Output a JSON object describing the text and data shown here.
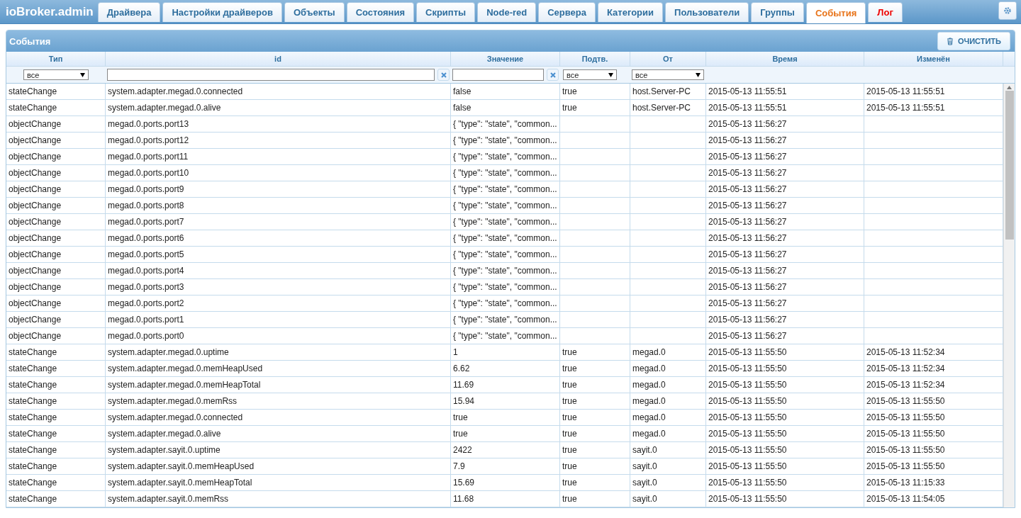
{
  "app": {
    "title": "ioBroker.admin"
  },
  "tabs": [
    {
      "label": "Драйвера",
      "selected": false,
      "warning": false
    },
    {
      "label": "Настройки драйверов",
      "selected": false,
      "warning": false
    },
    {
      "label": "Объекты",
      "selected": false,
      "warning": false
    },
    {
      "label": "Состояния",
      "selected": false,
      "warning": false
    },
    {
      "label": "Скрипты",
      "selected": false,
      "warning": false
    },
    {
      "label": "Node-red",
      "selected": false,
      "warning": false
    },
    {
      "label": "Сервера",
      "selected": false,
      "warning": false
    },
    {
      "label": "Категории",
      "selected": false,
      "warning": false
    },
    {
      "label": "Пользователи",
      "selected": false,
      "warning": false
    },
    {
      "label": "Группы",
      "selected": false,
      "warning": false
    },
    {
      "label": "События",
      "selected": true,
      "warning": false
    },
    {
      "label": "Лог",
      "selected": false,
      "warning": true
    }
  ],
  "panel": {
    "title": "События",
    "clear_button": "ОЧИСТИТЬ"
  },
  "table": {
    "columns": [
      "Тип",
      "id",
      "Значение",
      "Подтв.",
      "От",
      "Время",
      "Изменён"
    ],
    "filters": [
      {
        "kind": "select",
        "value": "все"
      },
      {
        "kind": "input"
      },
      {
        "kind": "input"
      },
      {
        "kind": "select",
        "value": "все"
      },
      {
        "kind": "select",
        "value": "все"
      },
      {
        "kind": "none"
      },
      {
        "kind": "none"
      }
    ],
    "rows": [
      [
        "stateChange",
        "system.adapter.megad.0.connected",
        "false",
        "true",
        "host.Server-PC",
        "2015-05-13 11:55:51",
        "2015-05-13 11:55:51"
      ],
      [
        "stateChange",
        "system.adapter.megad.0.alive",
        "false",
        "true",
        "host.Server-PC",
        "2015-05-13 11:55:51",
        "2015-05-13 11:55:51"
      ],
      [
        "objectChange",
        "megad.0.ports.port13",
        "{ \"type\": \"state\", \"common...",
        "",
        "",
        "2015-05-13 11:56:27",
        ""
      ],
      [
        "objectChange",
        "megad.0.ports.port12",
        "{ \"type\": \"state\", \"common...",
        "",
        "",
        "2015-05-13 11:56:27",
        ""
      ],
      [
        "objectChange",
        "megad.0.ports.port11",
        "{ \"type\": \"state\", \"common...",
        "",
        "",
        "2015-05-13 11:56:27",
        ""
      ],
      [
        "objectChange",
        "megad.0.ports.port10",
        "{ \"type\": \"state\", \"common...",
        "",
        "",
        "2015-05-13 11:56:27",
        ""
      ],
      [
        "objectChange",
        "megad.0.ports.port9",
        "{ \"type\": \"state\", \"common...",
        "",
        "",
        "2015-05-13 11:56:27",
        ""
      ],
      [
        "objectChange",
        "megad.0.ports.port8",
        "{ \"type\": \"state\", \"common...",
        "",
        "",
        "2015-05-13 11:56:27",
        ""
      ],
      [
        "objectChange",
        "megad.0.ports.port7",
        "{ \"type\": \"state\", \"common...",
        "",
        "",
        "2015-05-13 11:56:27",
        ""
      ],
      [
        "objectChange",
        "megad.0.ports.port6",
        "{ \"type\": \"state\", \"common...",
        "",
        "",
        "2015-05-13 11:56:27",
        ""
      ],
      [
        "objectChange",
        "megad.0.ports.port5",
        "{ \"type\": \"state\", \"common...",
        "",
        "",
        "2015-05-13 11:56:27",
        ""
      ],
      [
        "objectChange",
        "megad.0.ports.port4",
        "{ \"type\": \"state\", \"common...",
        "",
        "",
        "2015-05-13 11:56:27",
        ""
      ],
      [
        "objectChange",
        "megad.0.ports.port3",
        "{ \"type\": \"state\", \"common...",
        "",
        "",
        "2015-05-13 11:56:27",
        ""
      ],
      [
        "objectChange",
        "megad.0.ports.port2",
        "{ \"type\": \"state\", \"common...",
        "",
        "",
        "2015-05-13 11:56:27",
        ""
      ],
      [
        "objectChange",
        "megad.0.ports.port1",
        "{ \"type\": \"state\", \"common...",
        "",
        "",
        "2015-05-13 11:56:27",
        ""
      ],
      [
        "objectChange",
        "megad.0.ports.port0",
        "{ \"type\": \"state\", \"common...",
        "",
        "",
        "2015-05-13 11:56:27",
        ""
      ],
      [
        "stateChange",
        "system.adapter.megad.0.uptime",
        "1",
        "true",
        "megad.0",
        "2015-05-13 11:55:50",
        "2015-05-13 11:52:34"
      ],
      [
        "stateChange",
        "system.adapter.megad.0.memHeapUsed",
        "6.62",
        "true",
        "megad.0",
        "2015-05-13 11:55:50",
        "2015-05-13 11:52:34"
      ],
      [
        "stateChange",
        "system.adapter.megad.0.memHeapTotal",
        "11.69",
        "true",
        "megad.0",
        "2015-05-13 11:55:50",
        "2015-05-13 11:52:34"
      ],
      [
        "stateChange",
        "system.adapter.megad.0.memRss",
        "15.94",
        "true",
        "megad.0",
        "2015-05-13 11:55:50",
        "2015-05-13 11:55:50"
      ],
      [
        "stateChange",
        "system.adapter.megad.0.connected",
        "true",
        "true",
        "megad.0",
        "2015-05-13 11:55:50",
        "2015-05-13 11:55:50"
      ],
      [
        "stateChange",
        "system.adapter.megad.0.alive",
        "true",
        "true",
        "megad.0",
        "2015-05-13 11:55:50",
        "2015-05-13 11:55:50"
      ],
      [
        "stateChange",
        "system.adapter.sayit.0.uptime",
        "2422",
        "true",
        "sayit.0",
        "2015-05-13 11:55:50",
        "2015-05-13 11:55:50"
      ],
      [
        "stateChange",
        "system.adapter.sayit.0.memHeapUsed",
        "7.9",
        "true",
        "sayit.0",
        "2015-05-13 11:55:50",
        "2015-05-13 11:55:50"
      ],
      [
        "stateChange",
        "system.adapter.sayit.0.memHeapTotal",
        "15.69",
        "true",
        "sayit.0",
        "2015-05-13 11:55:50",
        "2015-05-13 11:15:33"
      ],
      [
        "stateChange",
        "system.adapter.sayit.0.memRss",
        "11.68",
        "true",
        "sayit.0",
        "2015-05-13 11:55:50",
        "2015-05-13 11:54:05"
      ]
    ]
  }
}
